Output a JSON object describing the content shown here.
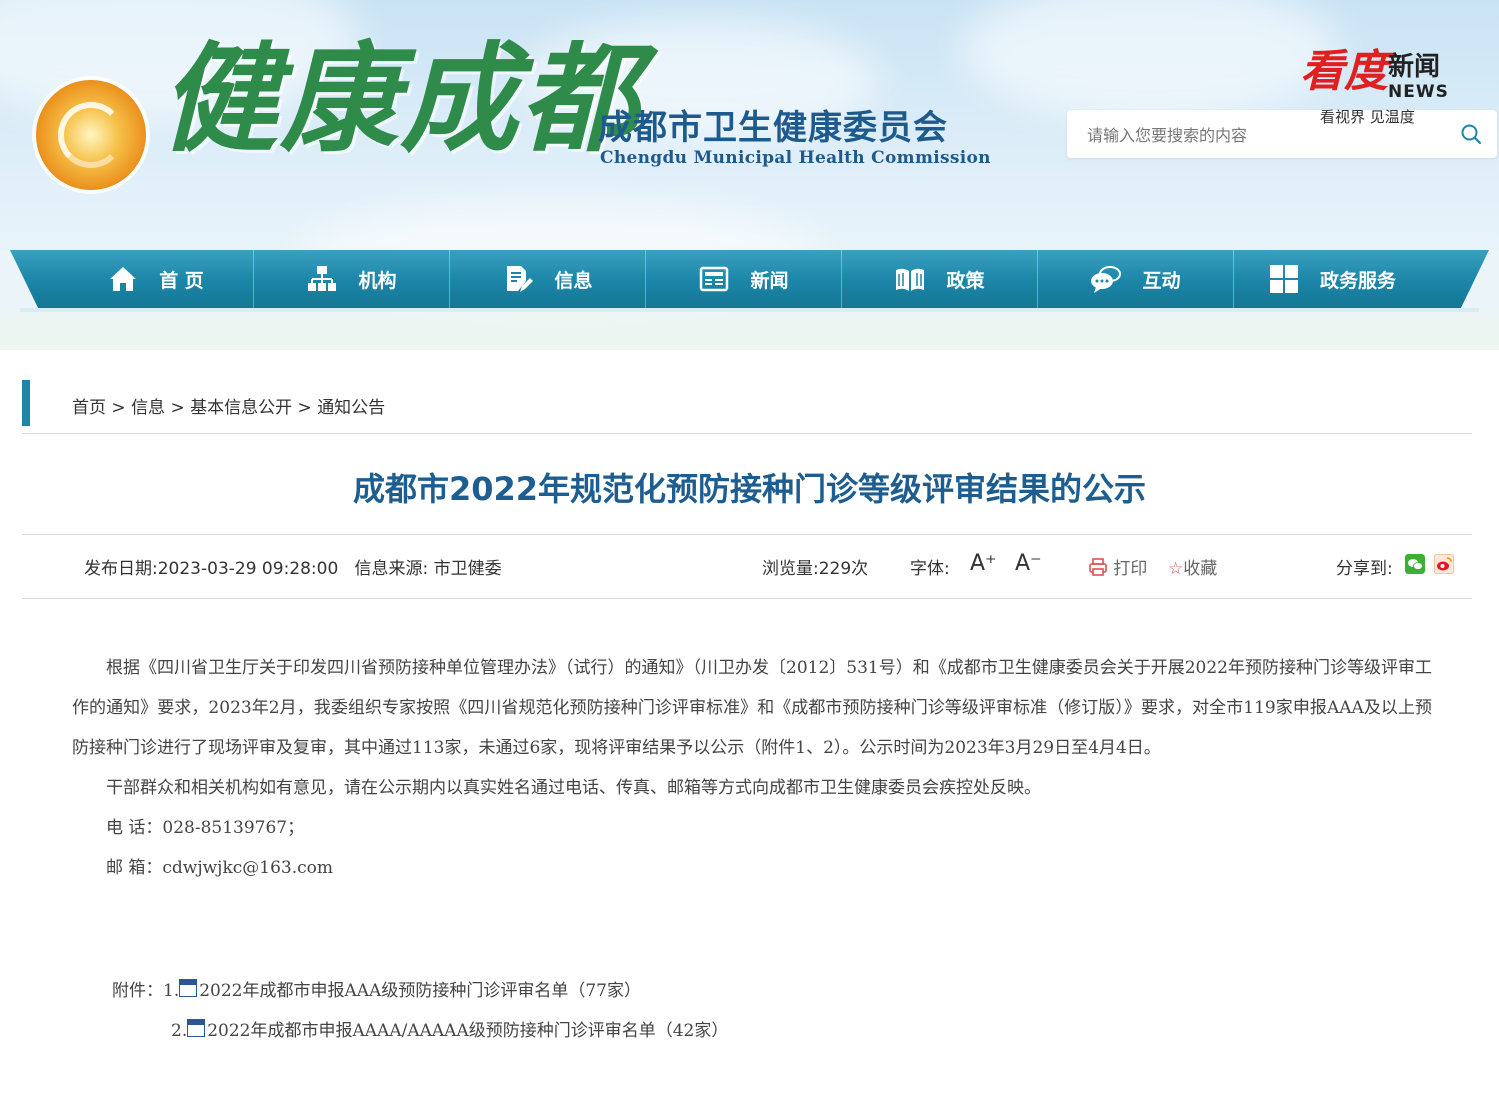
{
  "header": {
    "brand_title": "健康成都",
    "org_name_cn": "成都市卫生健康委员会",
    "org_name_en": "Chengdu Municipal Health Commission",
    "search_placeholder": "请输入您要搜索的内容"
  },
  "watermark": {
    "kan": "看度",
    "xinwen": "新闻",
    "news": "NEWS",
    "slogan": "看视界 见温度"
  },
  "nav": {
    "items": [
      {
        "label": "首 页",
        "icon": "home-icon"
      },
      {
        "label": "机构",
        "icon": "org-chart-icon"
      },
      {
        "label": "信息",
        "icon": "document-edit-icon"
      },
      {
        "label": "新闻",
        "icon": "newspaper-icon"
      },
      {
        "label": "政策",
        "icon": "book-icon"
      },
      {
        "label": "互动",
        "icon": "chat-bubbles-icon"
      },
      {
        "label": "政务服务",
        "icon": "grid-icon"
      }
    ]
  },
  "breadcrumb": {
    "items": [
      "首页",
      "信息",
      "基本信息公开",
      "通知公告"
    ],
    "separator": ">"
  },
  "article": {
    "title": "成都市2022年规范化预防接种门诊等级评审结果的公示",
    "publish_label": "发布日期:",
    "publish_date": "2023-03-29 09:28:00",
    "source_label": "信息来源:",
    "source": "市卫健委",
    "views": "浏览量:229次",
    "font_label": "字体:",
    "font_increase": "A⁺",
    "font_decrease": "A⁻",
    "print": "打印",
    "favorite": "收藏",
    "share_label": "分享到:",
    "paragraph1": "根据《四川省卫生厅关于印发四川省预防接种单位管理办法》（试行）的通知》（川卫办发〔2012〕531号）和《成都市卫生健康委员会关于开展2022年预防接种门诊等级评审工作的通知》要求，2023年2月，我委组织专家按照《四川省规范化预防接种门诊评审标准》和《成都市预防接种门诊等级评审标准（修订版）》要求，对全市119家申报AAA及以上预防接种门诊进行了现场评审及复审，其中通过113家，未通过6家，现将评审结果予以公示（附件1、2）。公示时间为2023年3月29日至4月4日。",
    "paragraph2": "干部群众和相关机构如有意见，请在公示期内以真实姓名通过电话、传真、邮箱等方式向成都市卫生健康委员会疾控处反映。",
    "phone": "电  话：028-85139767；",
    "email": "邮  箱：cdwjwjkc@163.com",
    "attach_label": "附件：",
    "attachments": [
      {
        "num": "1.",
        "name": "2022年成都市申报AAA级预防接种门诊评审名单（77家）"
      },
      {
        "num": "2.",
        "name": "2022年成都市申报AAAA/AAAAA级预防接种门诊评审名单（42家）"
      }
    ]
  },
  "colors": {
    "nav": "#1c86a8",
    "title": "#1e5d8f",
    "brand_green": "#2e8b4a",
    "watermark_red": "#e02020"
  }
}
